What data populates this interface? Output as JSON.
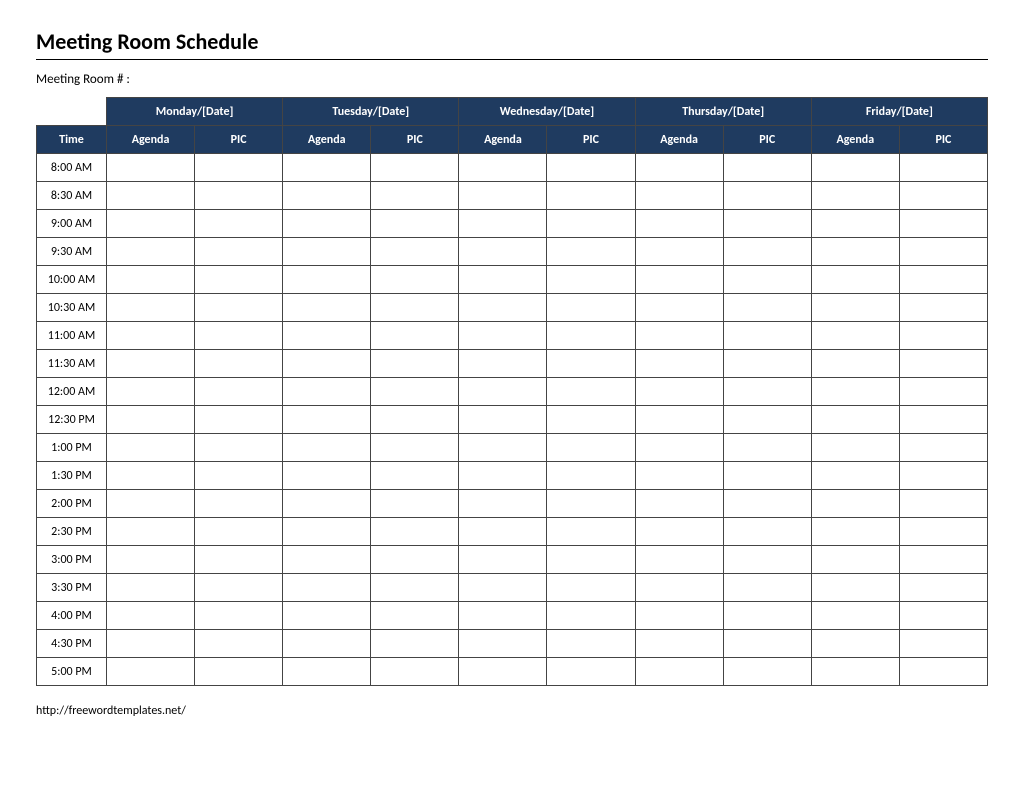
{
  "title": "Meeting Room Schedule",
  "room_label": "Meeting Room # :",
  "columns": {
    "time": "Time",
    "agenda": "Agenda",
    "pic": "PIC"
  },
  "days": [
    "Monday/[Date]",
    "Tuesday/[Date]",
    "Wednesday/[Date]",
    "Thursday/[Date]",
    "Friday/[Date]"
  ],
  "times": [
    "8:00 AM",
    "8:30 AM",
    "9:00 AM",
    "9:30 AM",
    "10:00 AM",
    "10:30 AM",
    "11:00 AM",
    "11:30 AM",
    "12:00 AM",
    "12:30 PM",
    "1:00 PM",
    "1:30 PM",
    "2:00 PM",
    "2:30 PM",
    "3:00 PM",
    "3:30 PM",
    "4:00 PM",
    "4:30 PM",
    "5:00 PM"
  ],
  "footer": "http://freewordtemplates.net/"
}
